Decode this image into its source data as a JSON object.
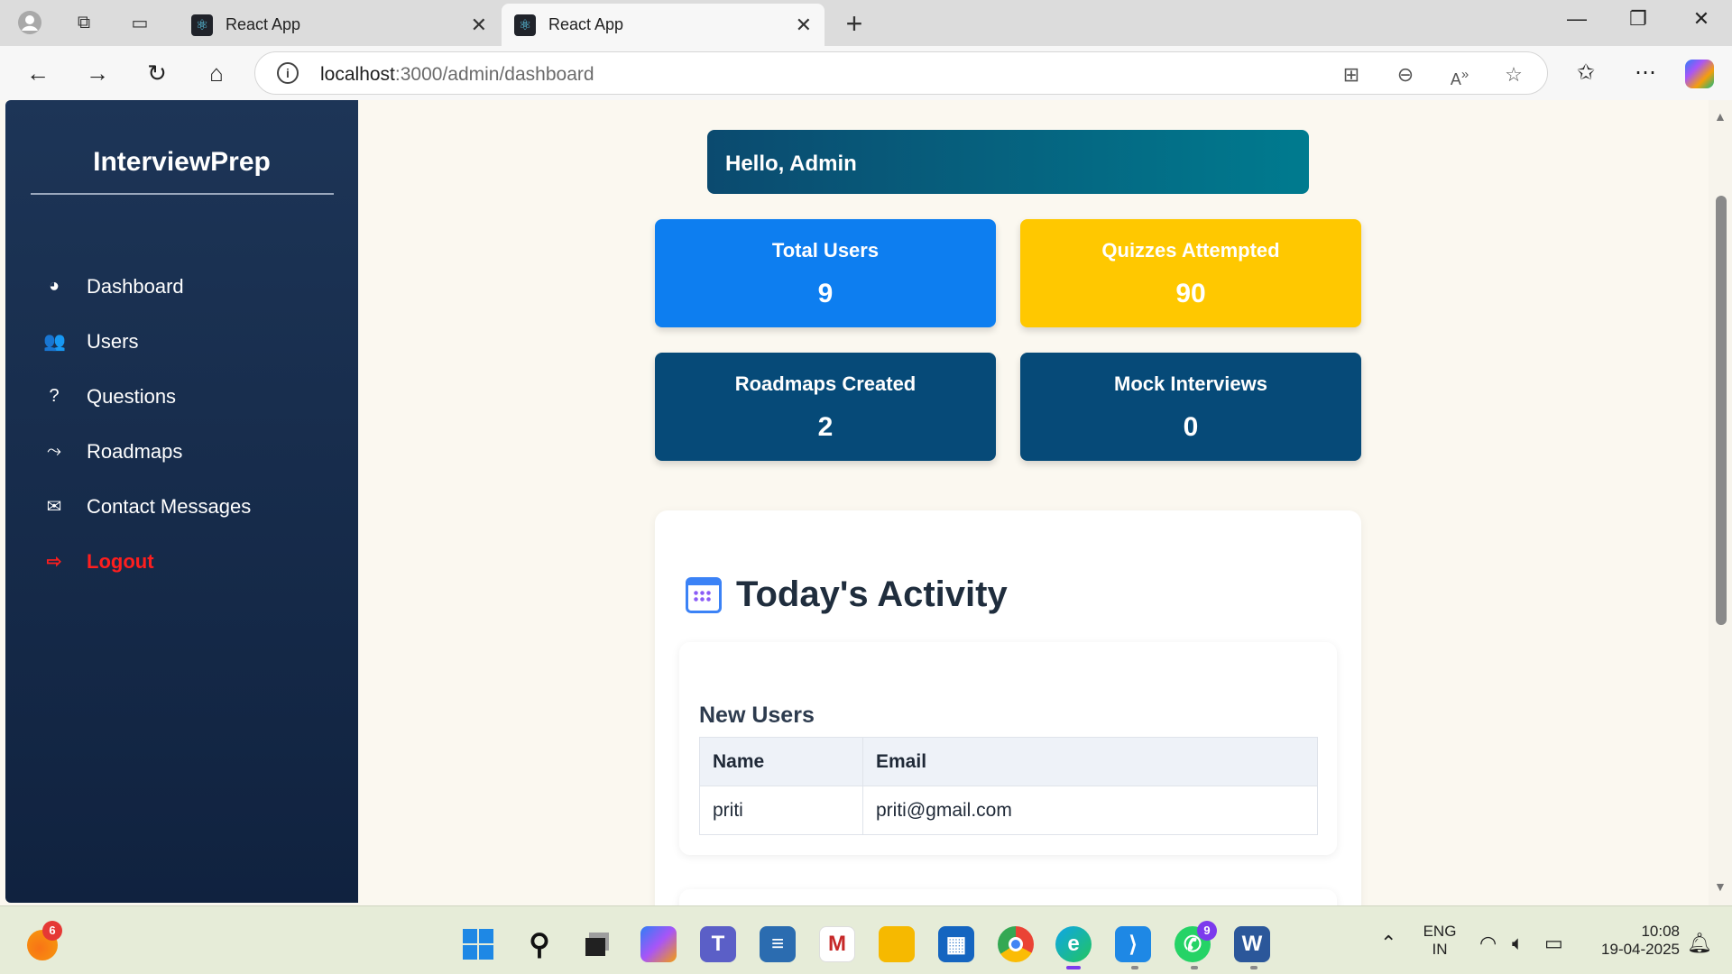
{
  "browser": {
    "tabs": [
      {
        "title": "React App",
        "active": false
      },
      {
        "title": "React App",
        "active": true
      }
    ],
    "url_host": "localhost",
    "url_path": ":3000/admin/dashboard"
  },
  "sidebar": {
    "brand": "InterviewPrep",
    "items": [
      {
        "label": "Dashboard",
        "icon": "tachometer-icon"
      },
      {
        "label": "Users",
        "icon": "users-icon"
      },
      {
        "label": "Questions",
        "icon": "question-circle-icon"
      },
      {
        "label": "Roadmaps",
        "icon": "route-icon"
      },
      {
        "label": "Contact Messages",
        "icon": "envelope-icon"
      },
      {
        "label": "Logout",
        "icon": "sign-out-icon"
      }
    ]
  },
  "main": {
    "greeting": "Hello, Admin",
    "stats": [
      {
        "label": "Total Users",
        "value": "9",
        "color": "#0d7ef0"
      },
      {
        "label": "Quizzes Attempted",
        "value": "90",
        "color": "#ffc800"
      },
      {
        "label": "Roadmaps Created",
        "value": "2",
        "color": "#064a78"
      },
      {
        "label": "Mock Interviews",
        "value": "0",
        "color": "#064a78"
      }
    ],
    "activity": {
      "title": "Today's Activity",
      "new_users": {
        "title": "New Users",
        "headers": [
          "Name",
          "Email"
        ],
        "rows": [
          [
            "priti",
            "priti@gmail.com"
          ]
        ]
      }
    }
  },
  "taskbar": {
    "notification_badge": "6",
    "whatsapp_badge": "9",
    "language": "ENG",
    "region": "IN",
    "time": "10:08",
    "date": "19-04-2025"
  }
}
